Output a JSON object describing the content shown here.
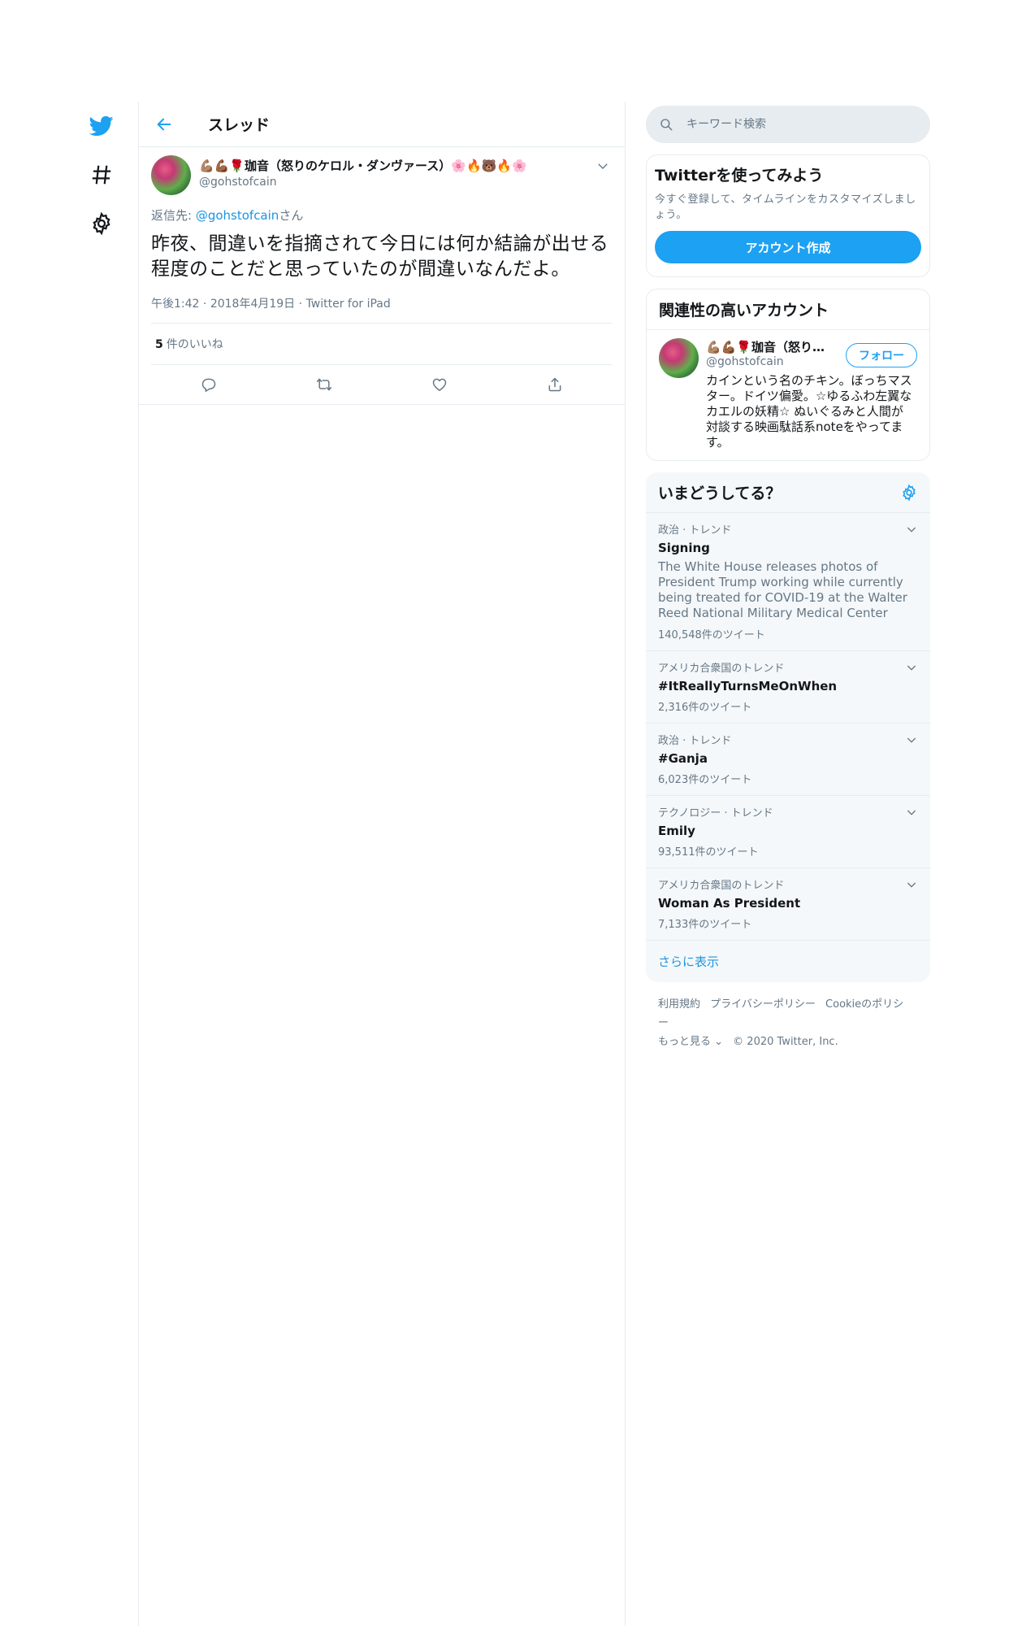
{
  "colors": {
    "accent": "#1da1f2",
    "link": "#1b95e0",
    "muted": "#657786",
    "border": "#e6ecf0"
  },
  "nav": {
    "items": [
      {
        "icon": "twitter-bird-icon"
      },
      {
        "icon": "hashtag-icon"
      },
      {
        "icon": "settings-gear-icon"
      }
    ]
  },
  "header": {
    "title": "スレッド"
  },
  "tweet": {
    "display_name": "💪🏽💪🏾🌹珈音（怒りのケロル・ダンヴァース）🌸🔥🐻🔥🌸",
    "handle": "@gohstofcain",
    "reply_prefix": "返信先: ",
    "reply_handle": "@gohstofcain",
    "reply_suffix": "さん",
    "text": "昨夜、間違いを指摘されて今日には何か結論が出せる程度のことだと思っていたのが間違いなんだよ。",
    "time": "午後1:42",
    "date": "2018年4月19日",
    "source": "Twitter for iPad",
    "like_count": "5",
    "like_label": "件のいいね"
  },
  "search": {
    "placeholder": "キーワード検索"
  },
  "signup_card": {
    "title": "Twitterを使ってみよう",
    "subtitle": "今すぐ登録して、タイムラインをカスタマイズしましょう。",
    "button": "アカウント作成"
  },
  "related": {
    "title": "関連性の高いアカウント",
    "user": {
      "name": "💪🏽💪🏾🌹珈音（怒りのケロル・ダンヴァース）",
      "handle": "@gohstofcain",
      "bio": "カインという名のチキン。ぼっちマスター。ドイツ偏愛。☆ゆるふわ左翼なカエルの妖精☆ ぬいぐるみと人間が対談する映画駄話系noteをやってます。",
      "follow": "フォロー"
    }
  },
  "trends": {
    "title": "いまどうしてる？",
    "items": [
      {
        "context": "政治 · トレンド",
        "name": "Signing",
        "desc": "The White House releases photos of President Trump working while currently being treated for COVID-19 at the Walter Reed National Military Medical Center",
        "count": "140,548件のツイート"
      },
      {
        "context": "アメリカ合衆国のトレンド",
        "name": "#ItReallyTurnsMeOnWhen",
        "desc": "",
        "count": "2,316件のツイート"
      },
      {
        "context": "政治 · トレンド",
        "name": "#Ganja",
        "desc": "",
        "count": "6,023件のツイート"
      },
      {
        "context": "テクノロジー · トレンド",
        "name": "Emily",
        "desc": "",
        "count": "93,511件のツイート"
      },
      {
        "context": "アメリカ合衆国のトレンド",
        "name": "Woman As President",
        "desc": "",
        "count": "7,133件のツイート"
      }
    ],
    "show_more": "さらに表示"
  },
  "footer": {
    "terms": "利用規約",
    "privacy": "プライバシーポリシー",
    "cookies": "Cookieのポリシー",
    "more": "もっと見る ⌄",
    "copyright": "© 2020 Twitter, Inc."
  }
}
